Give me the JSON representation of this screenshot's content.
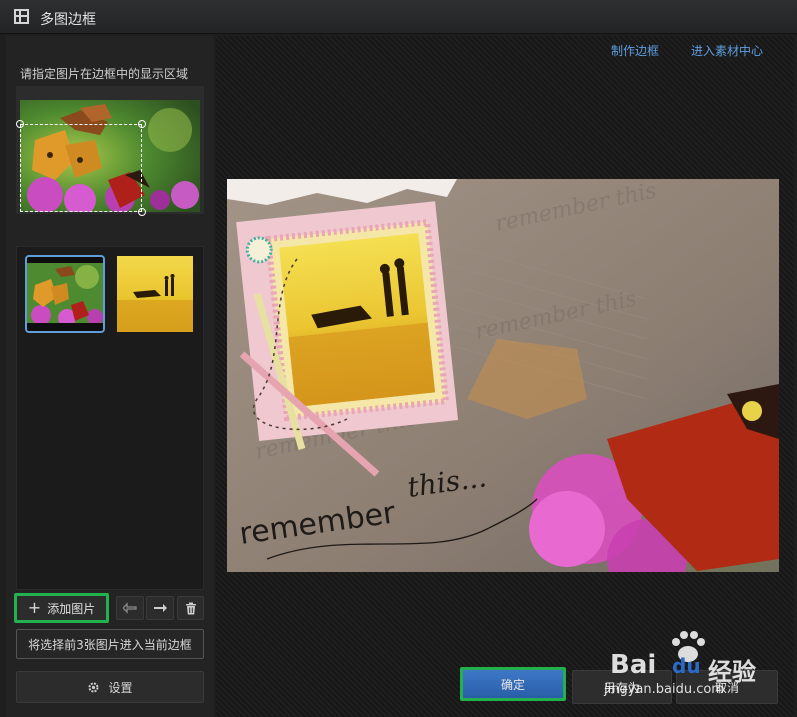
{
  "window": {
    "title": "多图边框"
  },
  "left_panel": {
    "hint": "请指定图片在边框中的显示区域",
    "add_image_label": "添加图片",
    "fill_label": "将选择前3张图片进入当前边框",
    "settings_label": "设置"
  },
  "top_links": {
    "make_frame": "制作边框",
    "material_center": "进入素材中心"
  },
  "preview": {
    "text_remember": "remember",
    "text_this": "this...",
    "text_pattern": "remember this"
  },
  "buttons": {
    "ok": "确定",
    "save_as": "另存为",
    "cancel": "取消"
  },
  "watermark": {
    "logo": "Bai",
    "logo_du": "du",
    "logo_cn": "经验",
    "url": "jingyan.baidu.com"
  },
  "icons": [
    "frame-icon",
    "plus-icon",
    "arrow-left-icon",
    "arrow-right-icon",
    "trash-icon",
    "gear-icon",
    "paw-icon"
  ],
  "colors": {
    "accent_link": "#5e9ee0",
    "ok_button": "#2f66b3",
    "highlight": "#22b14c",
    "thumb_selected": "#5f9ed8"
  }
}
